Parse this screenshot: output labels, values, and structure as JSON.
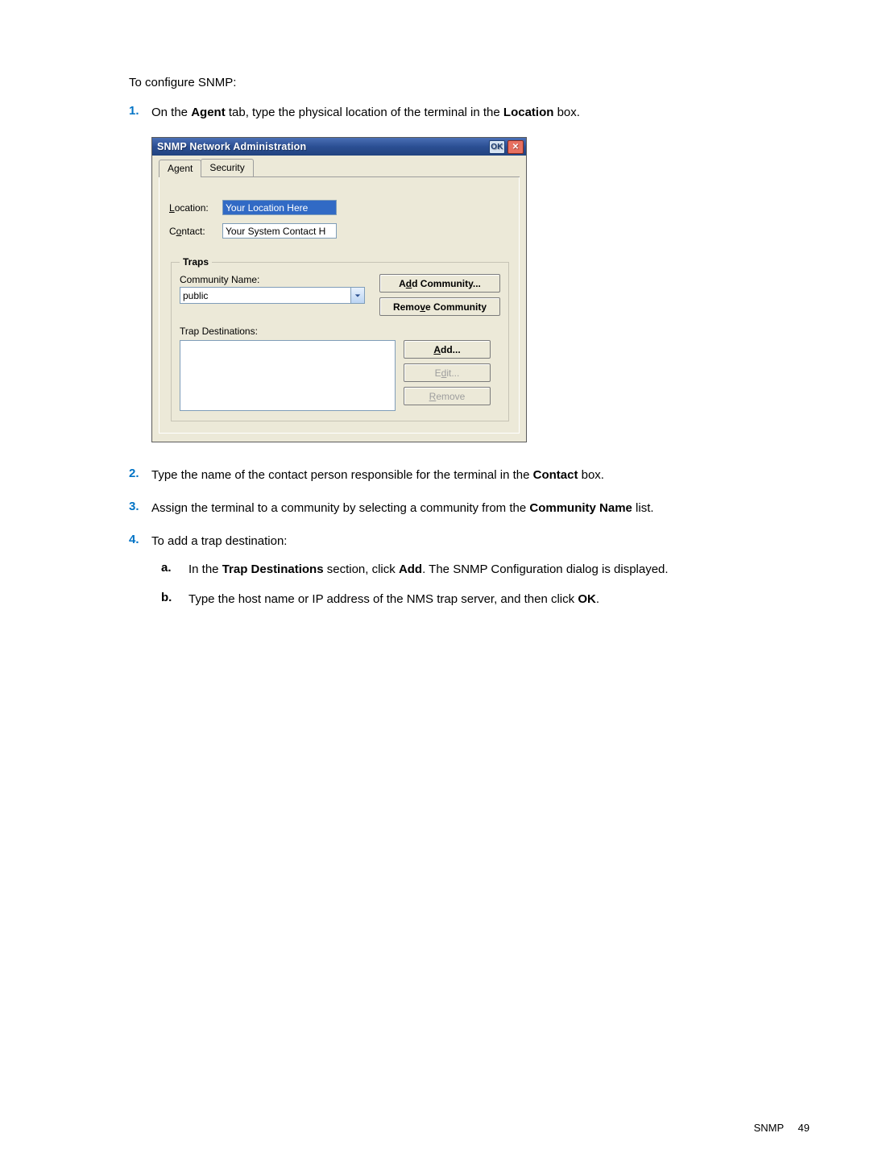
{
  "page": {
    "intro": "To configure SNMP:",
    "footer_section": "SNMP",
    "footer_page": "49"
  },
  "steps": {
    "s1_num": "1.",
    "s1_pre": "On the ",
    "s1_b1": "Agent",
    "s1_mid": " tab, type the physical location of the terminal in the ",
    "s1_b2": "Location",
    "s1_post": " box.",
    "s2_num": "2.",
    "s2_pre": "Type the name of the contact person responsible for the terminal in the ",
    "s2_b1": "Contact",
    "s2_post": " box.",
    "s3_num": "3.",
    "s3_pre": "Assign the terminal to a community by selecting a community from the ",
    "s3_b1": "Community Name",
    "s3_post": " list.",
    "s4_num": "4.",
    "s4_text": "To add a trap destination:",
    "s4a_letter": "a.",
    "s4a_pre": "In the ",
    "s4a_b1": "Trap Destinations",
    "s4a_mid": " section, click ",
    "s4a_b2": "Add",
    "s4a_post": ". The SNMP Configuration dialog is displayed.",
    "s4b_letter": "b.",
    "s4b_pre": "Type the host name or IP address of the NMS trap server, and then click ",
    "s4b_b1": "OK",
    "s4b_post": "."
  },
  "dialog": {
    "title": "SNMP Network Administration",
    "ok_btn": "OK",
    "tabs": {
      "agent": "Agent",
      "security": "Security"
    },
    "labels": {
      "location_pre": "L",
      "location_post": "ocation:",
      "contact_pre": "C",
      "contact_post": "ontact:",
      "traps_legend": "Traps",
      "community_name": "Community Name:",
      "trap_destinations": "Trap Destinations:"
    },
    "values": {
      "location": "Your Location Here",
      "contact": "Your System Contact H",
      "community_selected": "public"
    },
    "buttons": {
      "add_community_pre": "A",
      "add_community_u": "d",
      "add_community_post": "d Community...",
      "remove_community_pre": "Remo",
      "remove_community_u": "v",
      "remove_community_post": "e Community",
      "add_u": "A",
      "add_post": "dd...",
      "edit_pre": "E",
      "edit_u": "d",
      "edit_post": "it...",
      "remove_u": "R",
      "remove_post": "emove"
    }
  }
}
